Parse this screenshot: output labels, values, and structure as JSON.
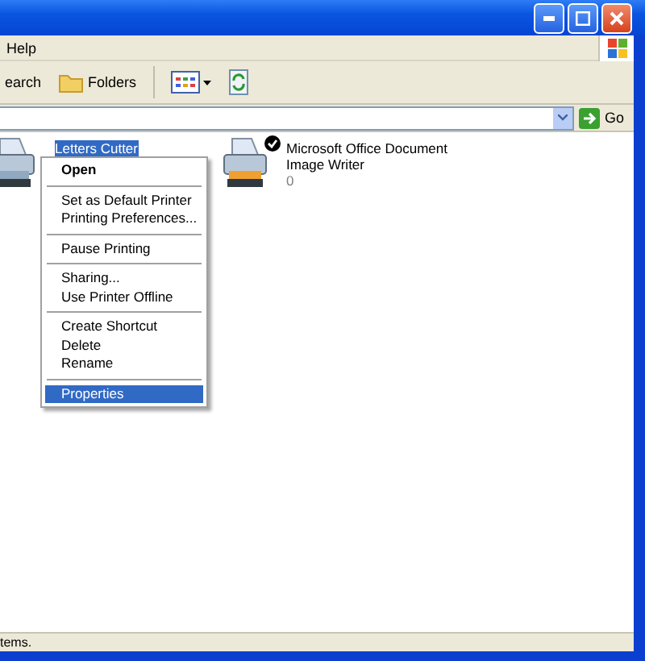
{
  "menu_bar": {
    "items": [
      {
        "label": "Help"
      }
    ]
  },
  "toolbar": {
    "buttons": [
      {
        "kind": "text",
        "label": "earch"
      },
      {
        "kind": "folders",
        "label": "Folders"
      },
      {
        "kind": "views"
      },
      {
        "kind": "refresh"
      }
    ]
  },
  "address_bar": {
    "go_label": "Go"
  },
  "printers": [
    {
      "name_lines": [
        "Letters Cutter"
      ],
      "selected": true,
      "default": false
    },
    {
      "name_lines": [
        "Microsoft Office Document",
        "Image Writer"
      ],
      "documents": "0",
      "selected": false,
      "default": true
    }
  ],
  "context_menu": {
    "groups": [
      [
        {
          "label": "Open",
          "bold": true,
          "selected": false
        }
      ],
      [
        {
          "label": "Set as Default Printer",
          "bold": false,
          "selected": false
        },
        {
          "label": "Printing Preferences...",
          "bold": false,
          "selected": false
        }
      ],
      [
        {
          "label": "Pause Printing",
          "bold": false,
          "selected": false
        }
      ],
      [
        {
          "label": "Sharing...",
          "bold": false,
          "selected": false
        },
        {
          "label": "Use Printer Offline",
          "bold": false,
          "selected": false
        }
      ],
      [
        {
          "label": "Create Shortcut",
          "bold": false,
          "selected": false
        },
        {
          "label": "Delete",
          "bold": false,
          "selected": false
        },
        {
          "label": "Rename",
          "bold": false,
          "selected": false
        }
      ],
      [
        {
          "label": "Properties",
          "bold": false,
          "selected": true
        }
      ]
    ]
  },
  "status_bar": {
    "text": "tems."
  }
}
